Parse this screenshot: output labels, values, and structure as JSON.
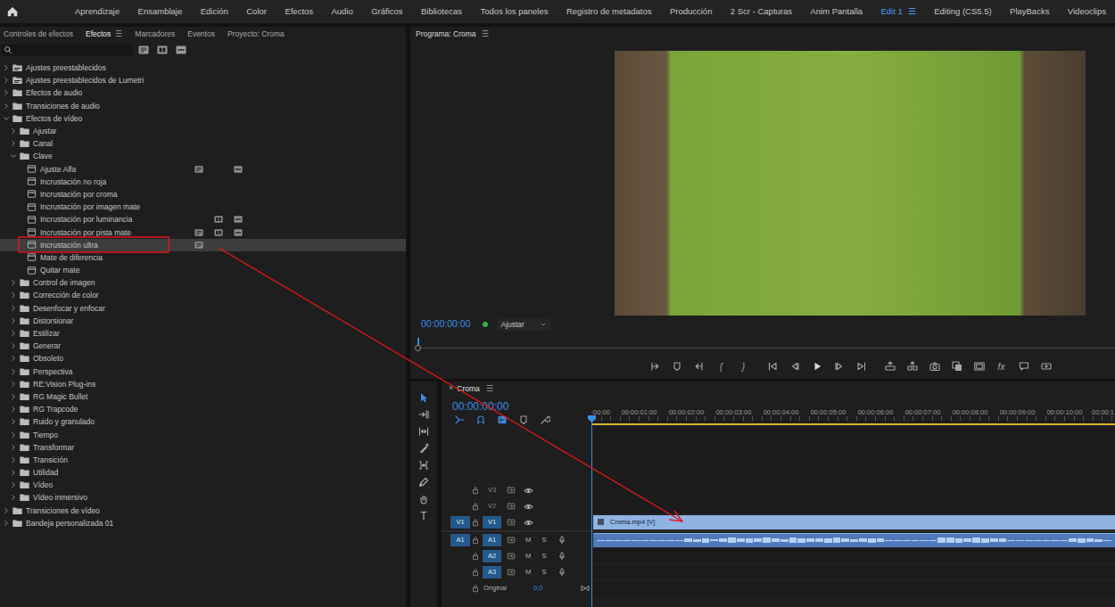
{
  "workspaces": [
    {
      "label": "Aprendizaje",
      "selected": false
    },
    {
      "label": "Ensamblaje",
      "selected": false
    },
    {
      "label": "Edición",
      "selected": false
    },
    {
      "label": "Color",
      "selected": false
    },
    {
      "label": "Efectos",
      "selected": false
    },
    {
      "label": "Audio",
      "selected": false
    },
    {
      "label": "Gráficos",
      "selected": false
    },
    {
      "label": "Bibliotecas",
      "selected": false
    },
    {
      "label": "Todos los paneles",
      "selected": false
    },
    {
      "label": "Registro de metadatos",
      "selected": false
    },
    {
      "label": "Producción",
      "selected": false
    },
    {
      "label": "2 Scr - Capturas",
      "selected": false
    },
    {
      "label": "Anim Pantalla",
      "selected": false
    },
    {
      "label": "Edit 1",
      "selected": true
    },
    {
      "label": "Editing (CS5.5)",
      "selected": false
    },
    {
      "label": "PlayBacks",
      "selected": false
    },
    {
      "label": "Videoclips",
      "selected": false
    }
  ],
  "workspace_menu": "☰",
  "effects_panel": {
    "tabs": [
      {
        "label": "Controles de efectos",
        "selected": false
      },
      {
        "label": "Efectos",
        "selected": true
      },
      {
        "label": "Marcadores",
        "selected": false
      },
      {
        "label": "Eventos",
        "selected": false
      },
      {
        "label": "Proyecto: Croma",
        "selected": false
      }
    ],
    "menu_glyph": "☰",
    "filters": [
      {
        "on": false
      },
      {
        "on": false
      },
      {
        "on": false
      }
    ],
    "tree": [
      {
        "label": "Ajustes preestablecidos",
        "kind": "preset",
        "expanded": false,
        "selected": false
      },
      {
        "label": "Ajustes preestablecidos de Lumetri",
        "kind": "preset",
        "expanded": false,
        "selected": false
      },
      {
        "label": "Efectos de audio",
        "kind": "folder",
        "expanded": false,
        "selected": false
      },
      {
        "label": "Transiciones de audio",
        "kind": "folder",
        "expanded": false,
        "selected": false
      },
      {
        "label": "Efectos de vídeo",
        "kind": "folder",
        "expanded": true,
        "selected": false,
        "children": [
          {
            "label": "Ajustar",
            "kind": "folder",
            "expanded": false,
            "selected": false
          },
          {
            "label": "Canal",
            "kind": "folder",
            "expanded": false,
            "selected": false
          },
          {
            "label": "Clave",
            "kind": "folder",
            "expanded": true,
            "selected": false,
            "children": [
              {
                "label": "Ajuste Alfa",
                "kind": "effect",
                "selected": false,
                "accelerated": true,
                "bit32": false,
                "yuv": true
              },
              {
                "label": "Incrustación no roja",
                "kind": "effect",
                "selected": false,
                "accelerated": false,
                "bit32": false,
                "yuv": false
              },
              {
                "label": "Incrustación por croma",
                "kind": "effect",
                "selected": false,
                "accelerated": false,
                "bit32": false,
                "yuv": false
              },
              {
                "label": "Incrustación por imagen mate",
                "kind": "effect",
                "selected": false,
                "accelerated": false,
                "bit32": false,
                "yuv": false
              },
              {
                "label": "Incrustación por luminancia",
                "kind": "effect",
                "selected": false,
                "accelerated": false,
                "bit32": true,
                "yuv": true
              },
              {
                "label": "Incrustación por pista mate",
                "kind": "effect",
                "selected": false,
                "accelerated": true,
                "bit32": true,
                "yuv": true
              },
              {
                "label": "Incrustación ultra",
                "kind": "effect",
                "selected": true,
                "accelerated": true,
                "bit32": false,
                "yuv": false
              },
              {
                "label": "Mate de diferencia",
                "kind": "effect",
                "selected": false,
                "accelerated": false,
                "bit32": false,
                "yuv": false
              },
              {
                "label": "Quitar mate",
                "kind": "effect",
                "selected": false,
                "accelerated": false,
                "bit32": false,
                "yuv": false
              }
            ]
          },
          {
            "label": "Control de imagen",
            "kind": "folder",
            "expanded": false,
            "selected": false
          },
          {
            "label": "Corrección de color",
            "kind": "folder",
            "expanded": false,
            "selected": false
          },
          {
            "label": "Desenfocar y enfocar",
            "kind": "folder",
            "expanded": false,
            "selected": false
          },
          {
            "label": "Distorsionar",
            "kind": "folder",
            "expanded": false,
            "selected": false
          },
          {
            "label": "Estilizar",
            "kind": "folder",
            "expanded": false,
            "selected": false
          },
          {
            "label": "Generar",
            "kind": "folder",
            "expanded": false,
            "selected": false
          },
          {
            "label": "Obsoleto",
            "kind": "folder",
            "expanded": false,
            "selected": false
          },
          {
            "label": "Perspectiva",
            "kind": "folder",
            "expanded": false,
            "selected": false
          },
          {
            "label": "RE:Vision Plug-ins",
            "kind": "folder",
            "expanded": false,
            "selected": false
          },
          {
            "label": "RG Magic Bullet",
            "kind": "folder",
            "expanded": false,
            "selected": false
          },
          {
            "label": "RG Trapcode",
            "kind": "folder",
            "expanded": false,
            "selected": false
          },
          {
            "label": "Ruido y granulado",
            "kind": "folder",
            "expanded": false,
            "selected": false
          },
          {
            "label": "Tiempo",
            "kind": "folder",
            "expanded": false,
            "selected": false
          },
          {
            "label": "Transformar",
            "kind": "folder",
            "expanded": false,
            "selected": false
          },
          {
            "label": "Transición",
            "kind": "folder",
            "expanded": false,
            "selected": false
          },
          {
            "label": "Utilidad",
            "kind": "folder",
            "expanded": false,
            "selected": false
          },
          {
            "label": "Vídeo",
            "kind": "folder",
            "expanded": false,
            "selected": false
          },
          {
            "label": "Vídeo inmersivo",
            "kind": "folder",
            "expanded": false,
            "selected": false
          }
        ]
      },
      {
        "label": "Transiciones de vídeo",
        "kind": "folder",
        "expanded": false,
        "selected": false
      },
      {
        "label": "Bandeja personalizada 01",
        "kind": "folder",
        "expanded": false,
        "selected": false
      }
    ]
  },
  "program": {
    "title": "Programa: Croma",
    "menu_glyph": "☰",
    "timecode": "00:00:00:00",
    "fit": "Ajustar",
    "transport_text": {
      "mark_clip_in": "{",
      "mark_clip_out": "}",
      "fx": "fx"
    }
  },
  "timeline": {
    "close_glyph": "×",
    "sequence": "Croma",
    "menu_glyph": "☰",
    "timecode": "00:00:00:00",
    "toggles": [
      {
        "on": true
      },
      {
        "on": true
      },
      {
        "on": true
      },
      {
        "on": false
      },
      {
        "on": false
      }
    ],
    "ruler": [
      ":00:00",
      "00:00:01:00",
      "00:00:02:00",
      "00:00:03:00",
      "00:00:04:00",
      "00:00:05:00",
      "00:00:06:00",
      "00:00:07:00",
      "00:00:08:00",
      "00:00:09:00",
      "00:00:10:00",
      "00:00:1"
    ],
    "tools": [
      {
        "selected": true
      },
      {
        "selected": false
      },
      {
        "selected": false
      },
      {
        "selected": false
      },
      {
        "selected": false
      },
      {
        "selected": false
      },
      {
        "selected": false
      },
      {
        "selected": false,
        "glyph": "T"
      }
    ],
    "video_tracks": [
      {
        "name": "V3",
        "source": null,
        "targeted": false,
        "visible": true
      },
      {
        "name": "V2",
        "source": null,
        "targeted": false,
        "visible": true
      },
      {
        "name": "V1",
        "source": "V1",
        "targeted": true,
        "visible": true,
        "clip": {
          "label": "Croma.mp4 [V]"
        }
      }
    ],
    "audio_tracks": [
      {
        "name": "A1",
        "source": "A1",
        "targeted": true,
        "mute": "M",
        "solo": "S",
        "clip": {
          "waveform": [
            0.1,
            0.05,
            0.05,
            0.1,
            0.05,
            0.05,
            0.05,
            0.05,
            0.05,
            0.1,
            0.3,
            0.2,
            0.35,
            0.15,
            0.3,
            0.4,
            0.25,
            0.35,
            0.3,
            0.45,
            0.3,
            0.2,
            0.4,
            0.35,
            0.3,
            0.25,
            0.35,
            0.4,
            0.3,
            0.2,
            0.3,
            0.35,
            0.3,
            0.1,
            0.05,
            0.05,
            0.05,
            0.1,
            0.05,
            0.4,
            0.45,
            0.35,
            0.3,
            0.4,
            0.35,
            0.3,
            0.25,
            0.1,
            0.05,
            0.05,
            0.05,
            0.05,
            0.05,
            0.05,
            0.3,
            0.35,
            0.3,
            0.2,
            0.1
          ]
        }
      },
      {
        "name": "A2",
        "source": null,
        "targeted": true,
        "mute": "M",
        "solo": "S"
      },
      {
        "name": "A3",
        "source": null,
        "targeted": true,
        "mute": "M",
        "solo": "S"
      }
    ],
    "master": {
      "label": "Original",
      "value": "0,0"
    }
  }
}
